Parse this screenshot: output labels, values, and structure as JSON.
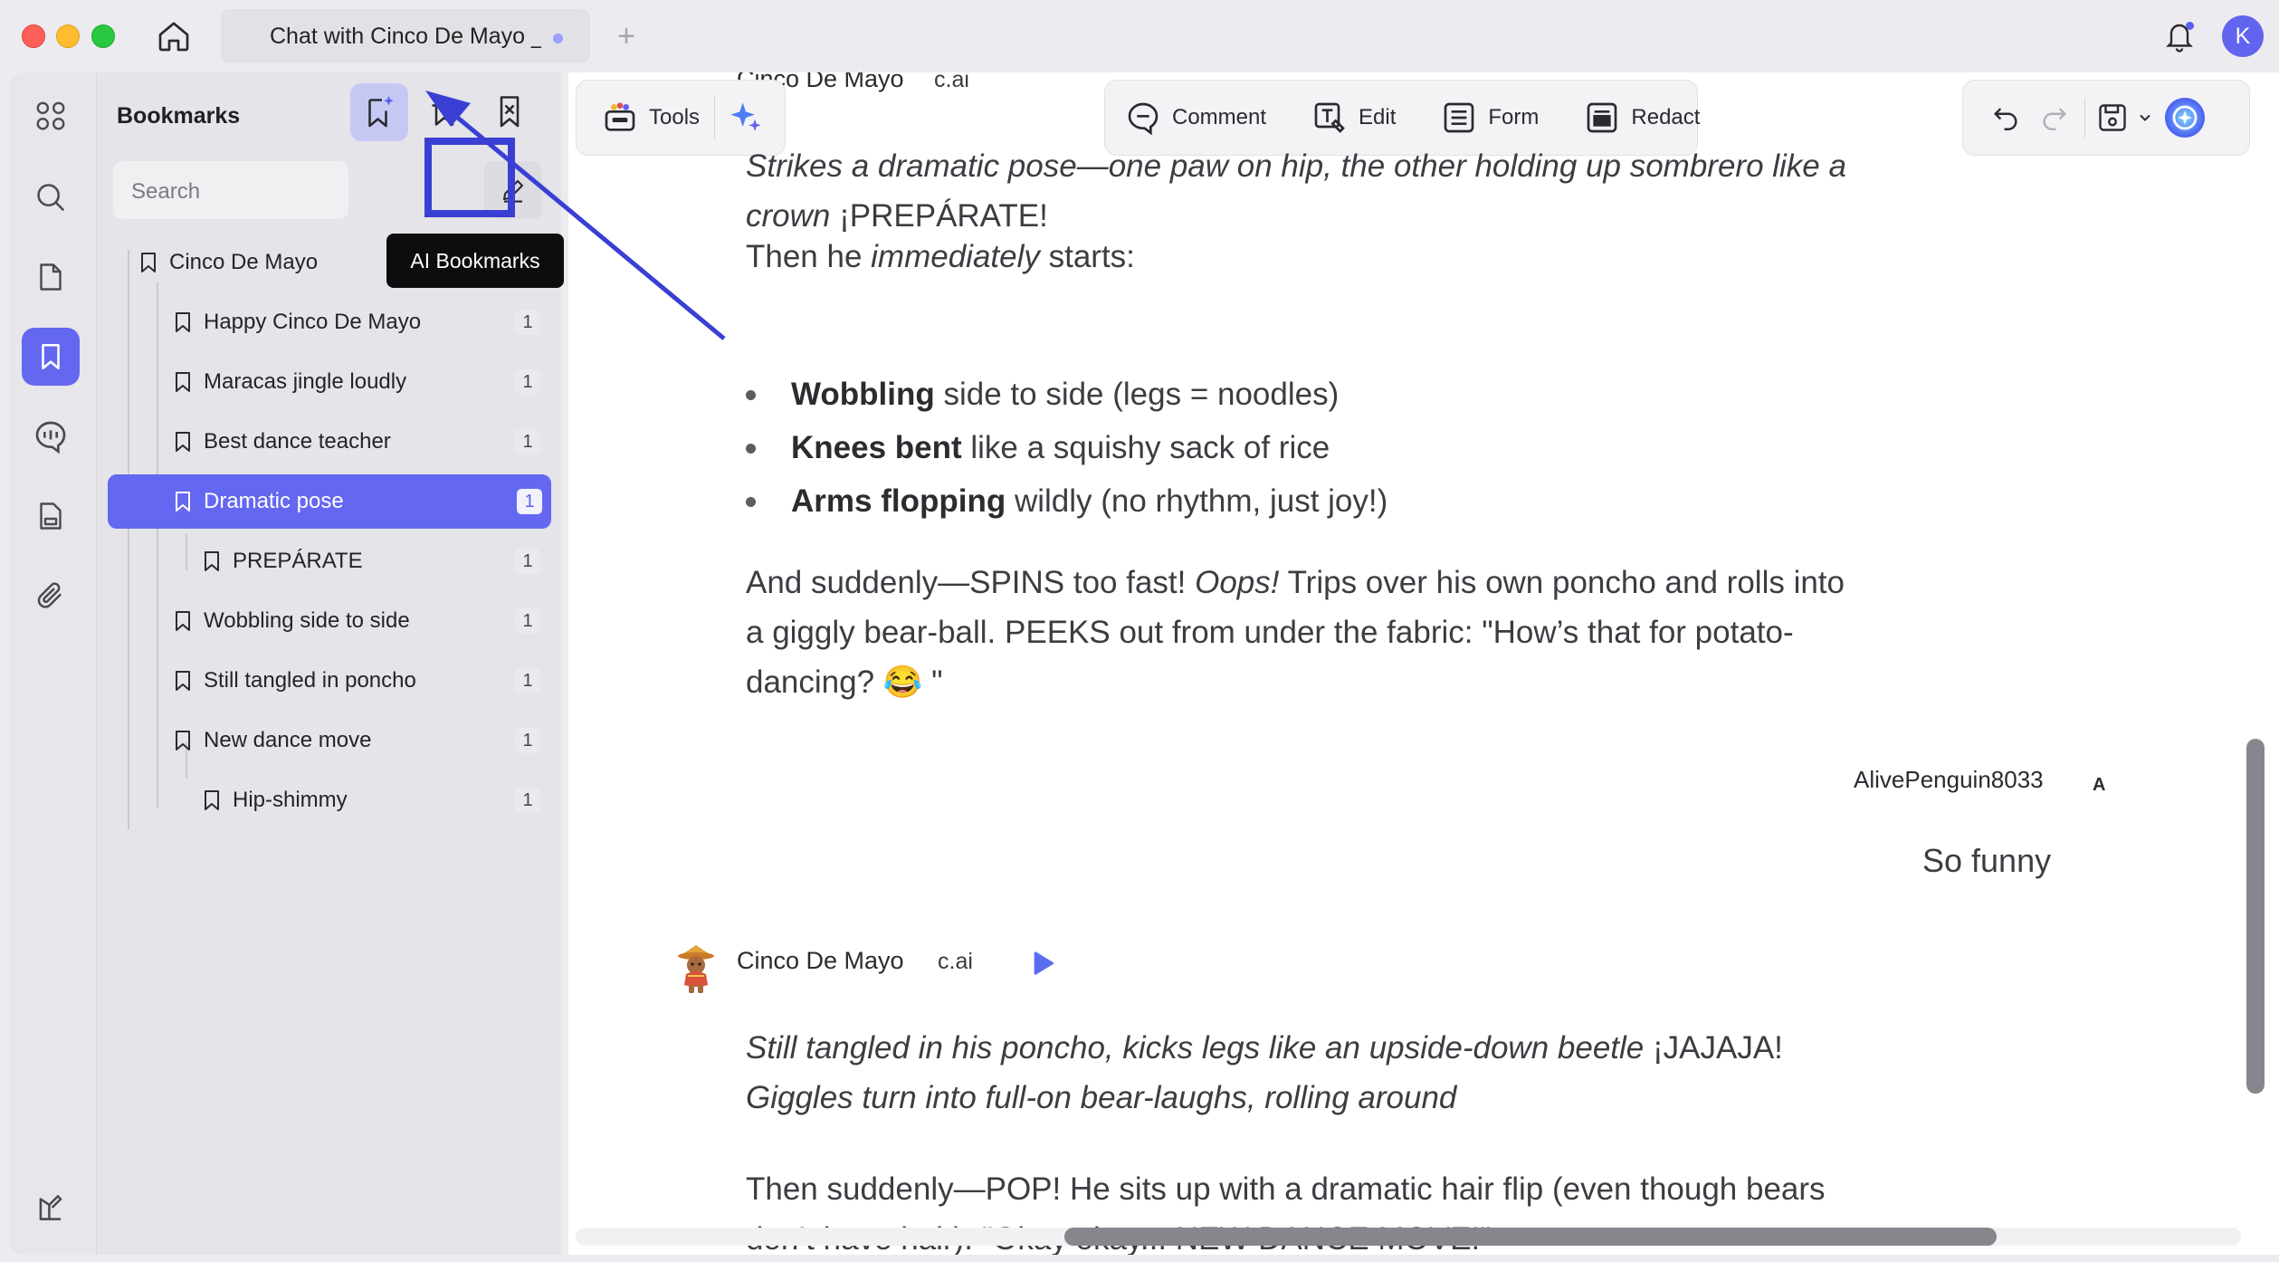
{
  "window": {
    "tab_title": "Chat with Cinco De Mayo _",
    "new_tab": "+",
    "avatar_initial": "K",
    "colors": {
      "accent": "#6468f0",
      "highlight": "#3a3fd4",
      "close": "#fe5f57",
      "minimize": "#febc2e",
      "maximize": "#28c840"
    }
  },
  "rail": {
    "items": [
      "apps-grid-icon",
      "search-icon",
      "pages-icon",
      "bookmark-icon",
      "comments-icon",
      "attachments-doc-icon",
      "paperclip-icon",
      "theme-icon"
    ],
    "active": "bookmark-icon"
  },
  "panel": {
    "title": "Bookmarks",
    "tooltip": "AI Bookmarks",
    "search_placeholder": "Search",
    "bookmarks": [
      {
        "label": "Cinco De Mayo",
        "count": "1",
        "level": 0
      },
      {
        "label": "Happy Cinco De Mayo",
        "count": "1",
        "level": 1
      },
      {
        "label": "Maracas jingle loudly",
        "count": "1",
        "level": 1
      },
      {
        "label": "Best dance teacher",
        "count": "1",
        "level": 1
      },
      {
        "label": "Dramatic pose",
        "count": "1",
        "level": 1,
        "active": true
      },
      {
        "label": "PREPÁRATE",
        "count": "1",
        "level": 2
      },
      {
        "label": "Wobbling side to side",
        "count": "1",
        "level": 1
      },
      {
        "label": "Still tangled in poncho",
        "count": "1",
        "level": 1
      },
      {
        "label": "New dance move",
        "count": "1",
        "level": 1
      },
      {
        "label": "Hip-shimmy",
        "count": "1",
        "level": 2
      }
    ]
  },
  "toolbar": {
    "tools_label": "Tools",
    "comment_label": "Comment",
    "edit_label": "Edit",
    "form_label": "Form",
    "redact_label": "Redact"
  },
  "chat": {
    "top_sender": {
      "name": "Cinco De Mayo",
      "tag": "c.ai"
    },
    "msg1_italic": "Strikes a dramatic pose—one paw on hip, the other holding up sombrero like a",
    "msg1_italic2": "crown",
    "msg1_tail": " ¡PREPÁRATE!",
    "msg2_a": "Then he ",
    "msg2_em": "immediately",
    "msg2_b": " starts:",
    "bullets": [
      {
        "bold": "Wobbling",
        "rest": " side to side (legs = noodles)"
      },
      {
        "bold": "Knees bent",
        "rest": " like a squishy sack of rice"
      },
      {
        "bold": "Arms flopping",
        "rest": " wildly (no rhythm, just joy!)"
      }
    ],
    "msg3_a": "And suddenly—SPINS too fast! ",
    "msg3_em": "Oops!",
    "msg3_b": " Trips over his own poncho and rolls into",
    "msg3_line2": "a giggly bear-ball. PEEKS out from under the fabric: \"How’s that for potato-",
    "msg3_line3": "dancing? 😂 \"",
    "user_name": "AlivePenguin8033",
    "user_badge": "A",
    "user_message": "So funny",
    "sender2": {
      "name": "Cinco De Mayo",
      "tag": "c.ai"
    },
    "msg4_em": "Still tangled in his poncho, kicks legs like an upside-down beetle",
    "msg4_tail": " ¡JAJAJA!",
    "msg4_line2": "Giggles turn into full-on bear-laughs, rolling around",
    "msg5_line1": "Then suddenly—POP! He sits up with a dramatic hair flip (even though bears",
    "msg5_line2": "don’t have hair). \"Okay okay... NEW DANCE MOVE!\""
  }
}
